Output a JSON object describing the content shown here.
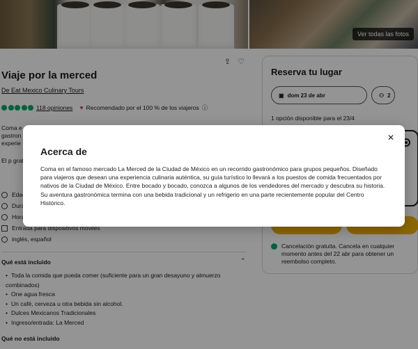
{
  "hero": {
    "see_all_photos_label": "Ver todas las fotos"
  },
  "tour": {
    "title": "Viaje por la merced",
    "operator": "De Eat Mexico Culinary Tours",
    "reviews_count_label": "118 opiniones",
    "recommended_label": "Recomendado por el 100 % de los viajeros",
    "description_peek": "Coma e gastron experie",
    "award_peek": "El p grat"
  },
  "features": [
    "Edad",
    "Dura",
    "Hora",
    "Entrada para dispositivos móviles",
    "inglés, español"
  ],
  "included": {
    "title": "Qué está incluido",
    "items": [
      "Toda la comida que pueda comer (suficiente para un gran desayuno y almuerzo combinados)",
      "One agua fresca",
      "Un café, cerveza u otra bebida sin alcohol.",
      "Dulces Mexicanos Tradicionales",
      "Ingreso/entrada: La Merced"
    ]
  },
  "not_included": {
    "title": "Qué no está incluido"
  },
  "booking": {
    "title": "Reserva tu lugar",
    "date_label": "dom 23 de abr",
    "guests_label": "2",
    "availability": "1 opción disponible para el 23/4",
    "cancellation": "Cancelación gratuita. Cancela en cualquier momento antes del 22 abr para obtener un reembolso completo."
  },
  "modal": {
    "title": "Acerca de",
    "body": "Coma en el famoso mercado La Merced de la Ciudad de México en un recorrido gastronómico para grupos pequeños. Diseñado para viajeros que desean una experiencia culinaria auténtica, su guía turístico lo llevará a los puestos de comida frecuentados por nativos de la Ciudad de México. Entre bocado y bocado, conozca a algunos de los vendedores del mercado y descubra su historia. Su aventura gastronómica termina con una bebida tradicional y un refrigerio en una parte recientemente popular del Centro Histórico.",
    "close_symbol": "✕"
  },
  "colors": {
    "accent_green": "#00aa6c",
    "cta_yellow": "#f2b203",
    "overlay": "rgba(0,0,0,0.42)"
  }
}
